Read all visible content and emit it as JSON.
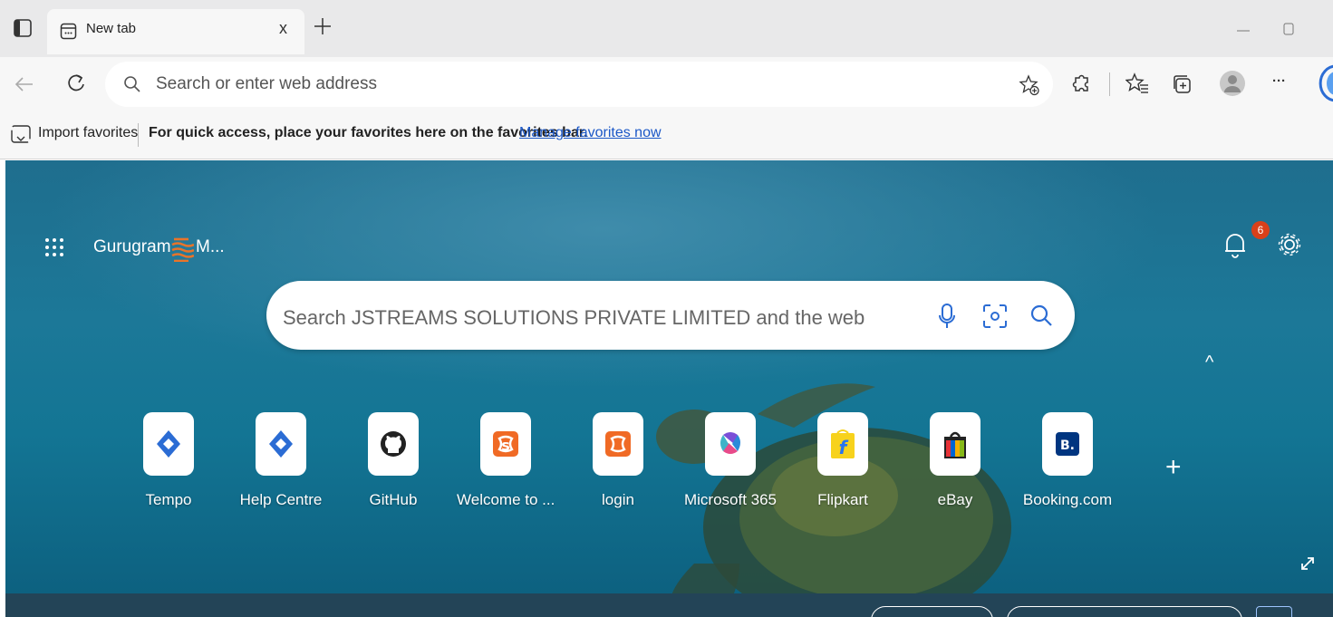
{
  "tab": {
    "title": "New tab",
    "close": "x"
  },
  "address": {
    "placeholder": "Search or enter web address"
  },
  "toolbar": {
    "more": "···"
  },
  "favorites_bar": {
    "import": "Import favorites",
    "message": "For quick access, place your favorites here on the favorites bar.",
    "manage_link": "Manage favorites now"
  },
  "new_tab_page": {
    "location": "Gurugram",
    "location_suffix": "M...",
    "search_placeholder": "Search JSTREAMS SOLUTIONS PRIVATE LIMITED and the web",
    "notification_count": "6",
    "collapse": "^",
    "add": "+"
  },
  "quick_links": [
    {
      "label": "Tempo",
      "icon": "tempo-icon"
    },
    {
      "label": "Help Centre",
      "icon": "jira-icon"
    },
    {
      "label": "GitHub",
      "icon": "github-icon"
    },
    {
      "label": "Welcome to ...",
      "icon": "xampp-icon"
    },
    {
      "label": "login",
      "icon": "xampp-icon"
    },
    {
      "label": "Microsoft 365",
      "icon": "microsoft-365-icon"
    },
    {
      "label": "Flipkart",
      "icon": "flipkart-icon"
    },
    {
      "label": "eBay",
      "icon": "ebay-icon"
    },
    {
      "label": "Booking.com",
      "icon": "booking-icon"
    }
  ],
  "colors": {
    "accent": "#2b6cd4",
    "link": "#1a57c7",
    "badge": "#d9401a",
    "bg": "#1c7898"
  }
}
